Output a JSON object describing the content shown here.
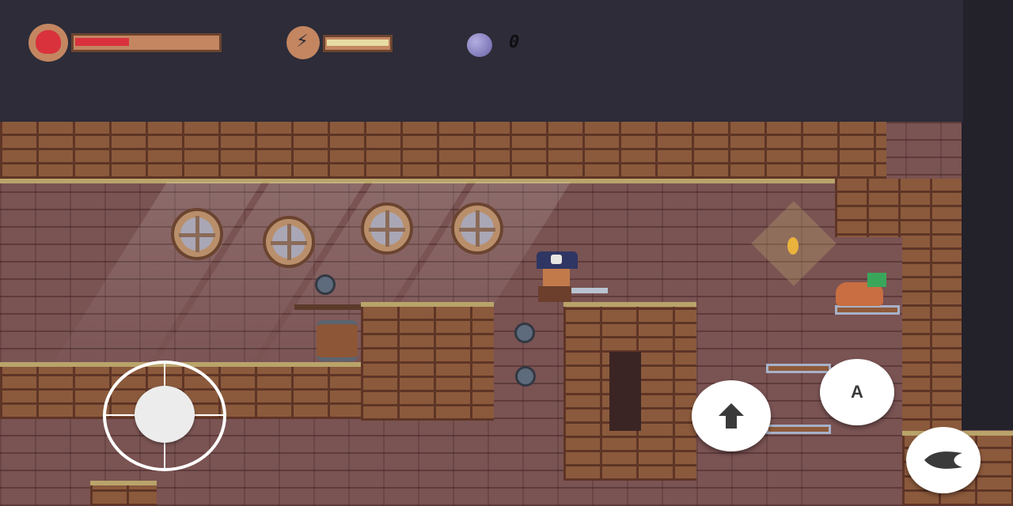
{
  "hud": {
    "health": {
      "icon": "heart-icon",
      "fill_fraction": 0.38,
      "fill_color": "#d9323d"
    },
    "energy": {
      "icon": "lightning-bolt-icon",
      "fill_fraction": 1.0,
      "fill_color": "#e7dca4"
    },
    "orbs": {
      "icon": "purple-orb-icon",
      "count": "0"
    }
  },
  "controls": {
    "joystick": "virtual-joystick",
    "jump_button": {
      "icon": "up-arrow-icon"
    },
    "attack_button": {
      "label": "A"
    },
    "dash_button": {
      "icon": "dash-arrow-icon"
    }
  },
  "colors": {
    "hud_background": "#2d2c38",
    "brick": "#8b5a3c",
    "wall": "#7a5353",
    "trim": "#b9a46a"
  }
}
